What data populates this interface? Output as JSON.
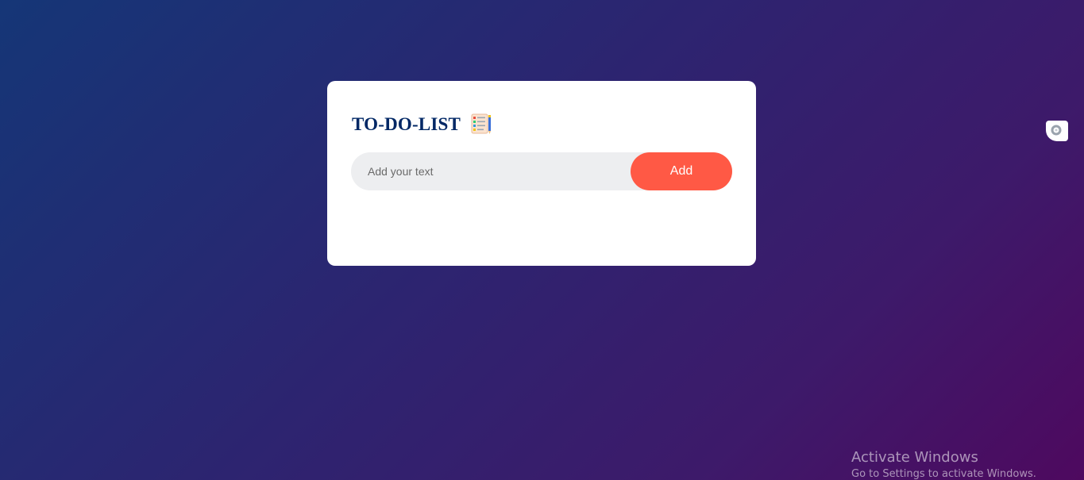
{
  "card": {
    "title": "TO-DO-LIST",
    "title_icon": "checklist-icon",
    "input_placeholder": "Add your text",
    "input_value": "",
    "add_label": "Add"
  },
  "side_widget": {
    "icon": "search-widget-icon"
  },
  "watermark": {
    "title": "Activate Windows",
    "subtitle": "Go to Settings to activate Windows."
  },
  "colors": {
    "title": "#002765",
    "add_button": "#ff5945",
    "input_bg": "#edeef0",
    "card_bg": "#ffffff"
  }
}
